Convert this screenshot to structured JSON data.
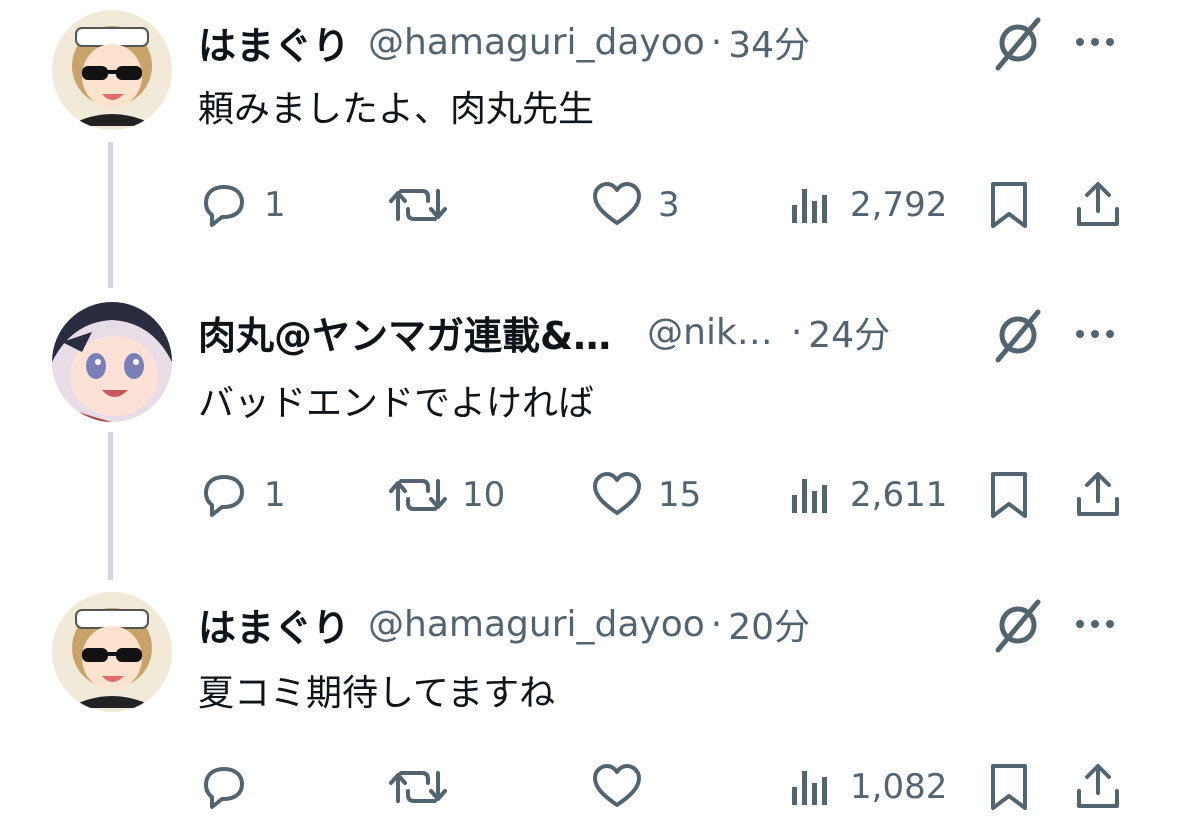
{
  "tweets": [
    {
      "name": "はまぐり",
      "handle": "@hamaguri_dayoo",
      "dot": "·",
      "time": "34分",
      "text": "頼みましたよ、肉丸先生",
      "reply_count": "1",
      "retweet_count": "",
      "like_count": "3",
      "view_count": "2,792"
    },
    {
      "name": "肉丸@ヤンマガ連載&…",
      "handle": "@nik…",
      "dot": "·",
      "time": "24分",
      "text": "バッドエンドでよければ",
      "reply_count": "1",
      "retweet_count": "10",
      "like_count": "15",
      "view_count": "2,611"
    },
    {
      "name": "はまぐり",
      "handle": "@hamaguri_dayoo",
      "dot": "·",
      "time": "20分",
      "text": "夏コミ期待してますね",
      "reply_count": "",
      "retweet_count": "",
      "like_count": "",
      "view_count": "1,082"
    }
  ],
  "icons": {
    "reply": "reply-bubble-icon",
    "retweet": "retweet-icon",
    "like": "heart-icon",
    "views": "analytics-bars-icon",
    "bookmark": "bookmark-icon",
    "share": "share-upload-icon",
    "grok": "grok-slash-icon",
    "more": "more-dots-icon"
  },
  "colors": {
    "text_primary": "#0f1419",
    "text_secondary": "#536471",
    "thread_line": "#cfd9de",
    "background": "#ffffff"
  }
}
